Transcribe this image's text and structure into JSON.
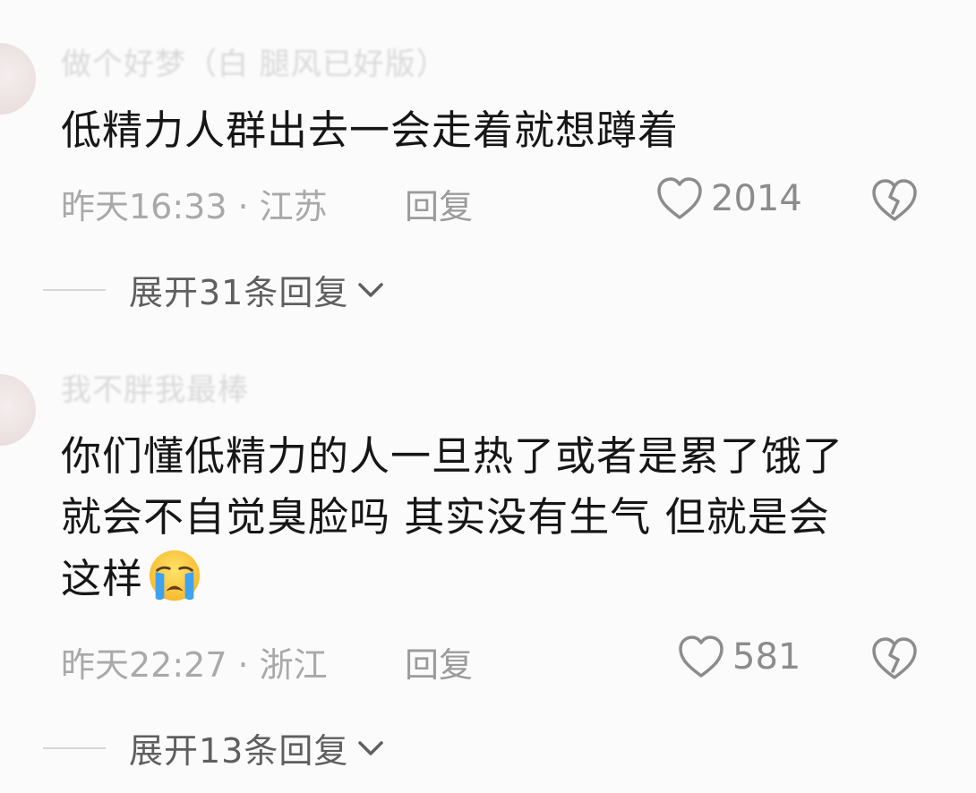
{
  "comments": [
    {
      "username": "做个好梦（白 腿风已好版）",
      "text": "低精力人群出去一会走着就想蹲着",
      "time": "昨天16:33",
      "location": "江苏",
      "reply_label": "回复",
      "likes": "2014",
      "expand_label": "展开31条回复"
    },
    {
      "username": "我不胖我最棒",
      "text_lines": [
        "你们懂低精力的人一旦热了或者是累了饿了",
        "就会不自觉臭脸吗 其实没有生气 但就是会",
        "这样"
      ],
      "emoji": "loudly-crying-face",
      "time": "昨天22:27",
      "location": "浙江",
      "reply_label": "回复",
      "likes": "581",
      "expand_label": "展开13条回复"
    }
  ],
  "separator": "·",
  "icons": {
    "like": "heart-outline-icon",
    "dislike": "broken-heart-icon",
    "expand": "chevron-down-icon"
  },
  "colors": {
    "background": "#fbfbfb",
    "text": "#161616",
    "meta": "#a9a9a9",
    "icon": "#8c8c8c"
  }
}
